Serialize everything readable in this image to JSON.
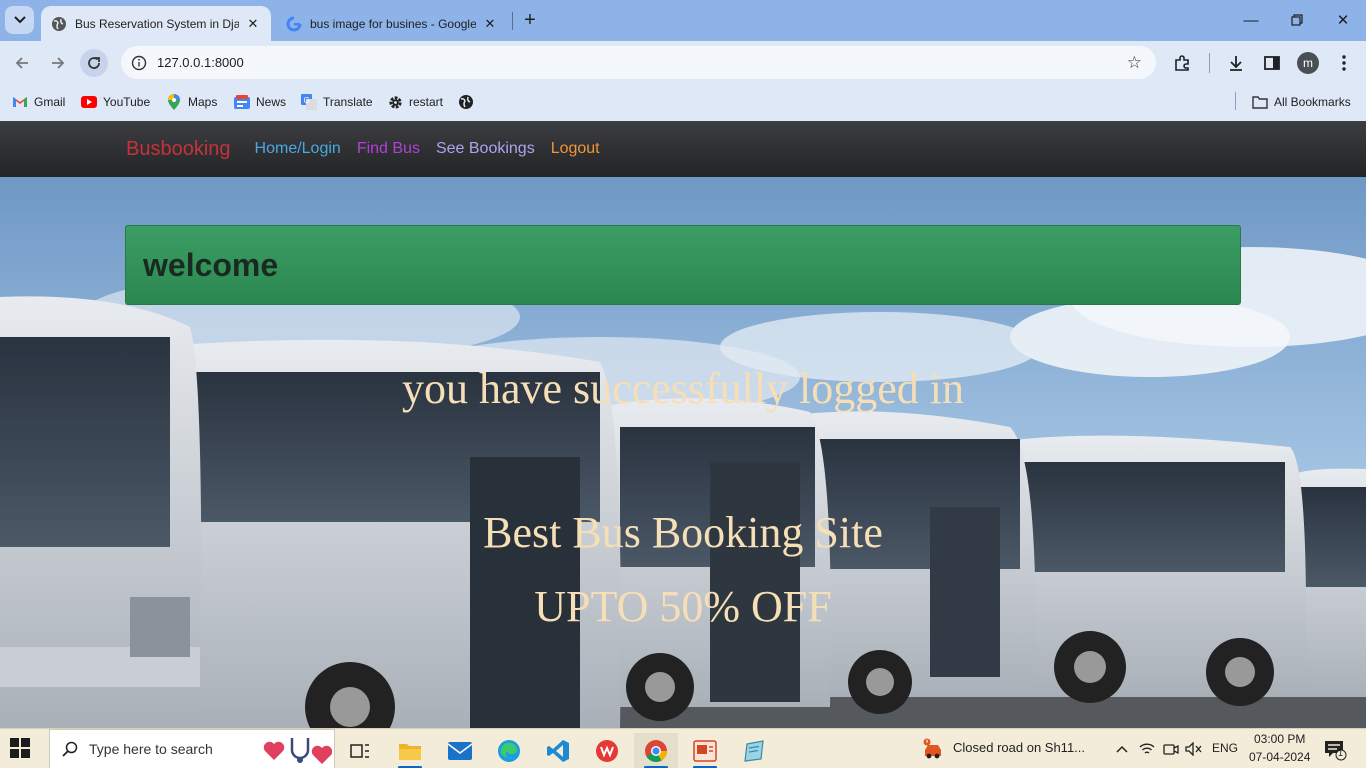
{
  "browser": {
    "tabs": [
      {
        "title": "Bus Reservation System in Djan",
        "active": true
      },
      {
        "title": "bus image for busines - Google",
        "active": false
      }
    ],
    "address": "127.0.0.1:8000",
    "bookmarks": [
      {
        "label": "Gmail",
        "icon": "gmail-icon"
      },
      {
        "label": "YouTube",
        "icon": "youtube-icon"
      },
      {
        "label": "Maps",
        "icon": "maps-icon"
      },
      {
        "label": "News",
        "icon": "news-icon"
      },
      {
        "label": "Translate",
        "icon": "translate-icon"
      },
      {
        "label": "restart",
        "icon": "gear-icon"
      },
      {
        "label": "",
        "icon": "globe-icon"
      }
    ],
    "all_bookmarks": "All Bookmarks",
    "profile_initial": "m"
  },
  "site": {
    "brand": "Busbooking",
    "nav": [
      {
        "label": "Home/Login",
        "color": "#4aa8e0"
      },
      {
        "label": "Find Bus",
        "color": "#b33fd8"
      },
      {
        "label": "See Bookings",
        "color": "#a8a6f0"
      },
      {
        "label": "Logout",
        "color": "#f0953a"
      }
    ],
    "brand_color": "#c6323a",
    "alert": "welcome",
    "message": "you have successfully logged in",
    "headline": "Best Bus Booking Site",
    "offer": "UPTO 50% OFF"
  },
  "taskbar": {
    "search_placeholder": "Type here to search",
    "apps": [
      "task-view",
      "file-explorer",
      "mail",
      "edge",
      "vscode",
      "wps-office",
      "chrome",
      "powerpoint",
      "notepad"
    ],
    "news": "Closed road on Sh11...",
    "language": "ENG",
    "time": "03:00 PM",
    "date": "07-04-2024",
    "notification_count": "1"
  }
}
